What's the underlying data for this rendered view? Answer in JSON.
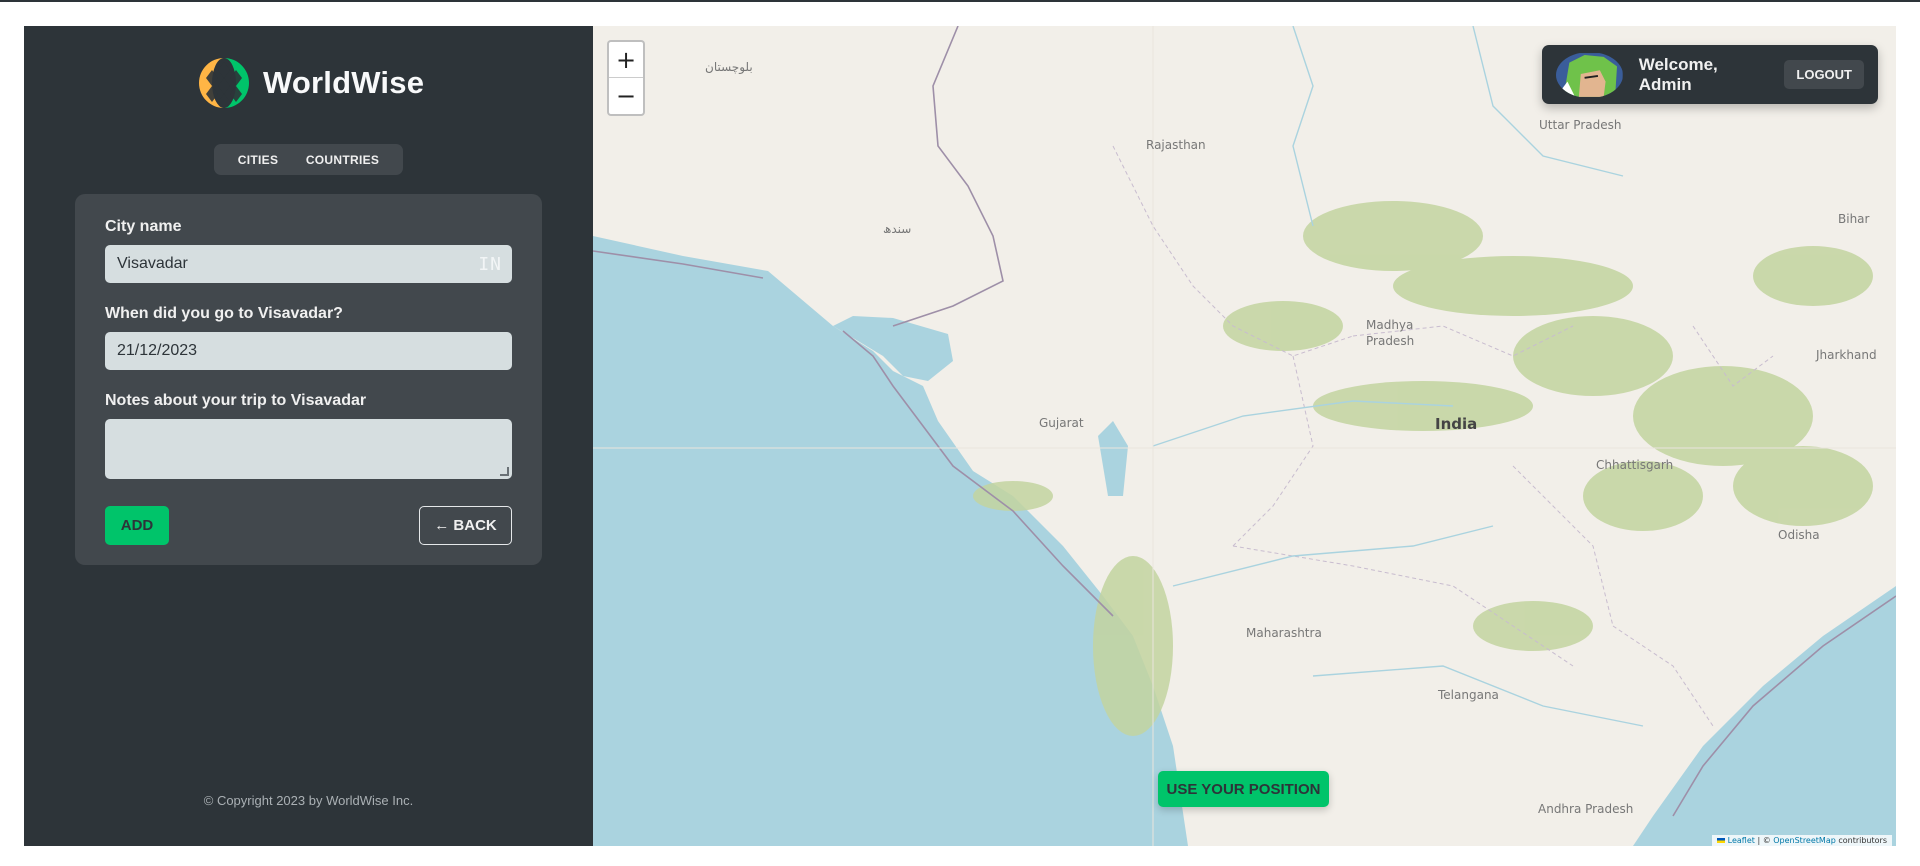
{
  "app": {
    "name": "WorldWise"
  },
  "nav": {
    "cities": "Cities",
    "countries": "Countries"
  },
  "form": {
    "city_label": "City name",
    "city_value": "Visavadar",
    "country_code": "IN",
    "date_label": "When did you go to Visavadar?",
    "date_value": "21/12/2023",
    "notes_label": "Notes about your trip to Visavadar",
    "notes_value": "",
    "add_label": "Add",
    "back_label": "← Back"
  },
  "footer": {
    "copyright": "© Copyright 2023 by WorldWise Inc."
  },
  "map": {
    "zoom_in": "+",
    "zoom_out": "−",
    "use_position": "Use your position",
    "labels": {
      "balochistan": "بلوچستان",
      "sindh": "سندھ",
      "rajasthan": "Rajasthan",
      "uttar_pradesh": "Uttar Pradesh",
      "bihar": "Bihar",
      "madhya_pradesh_1": "Madhya",
      "madhya_pradesh_2": "Pradesh",
      "jharkhand": "Jharkhand",
      "gujarat": "Gujarat",
      "india": "India",
      "chhattisgarh": "Chhattisgarh",
      "odisha": "Odisha",
      "maharashtra": "Maharashtra",
      "telangana": "Telangana",
      "andhra_pradesh": "Andhra Pradesh"
    },
    "attribution": {
      "leaflet": "Leaflet",
      "sep": " | © ",
      "osm": "OpenStreetMap",
      "suffix": " contributors"
    },
    "colors": {
      "water": "#aad3df",
      "land": "#f2efe9",
      "forest": "#c3d4a0"
    }
  },
  "user": {
    "welcome": "Welcome, Admin",
    "logout": "Logout"
  }
}
